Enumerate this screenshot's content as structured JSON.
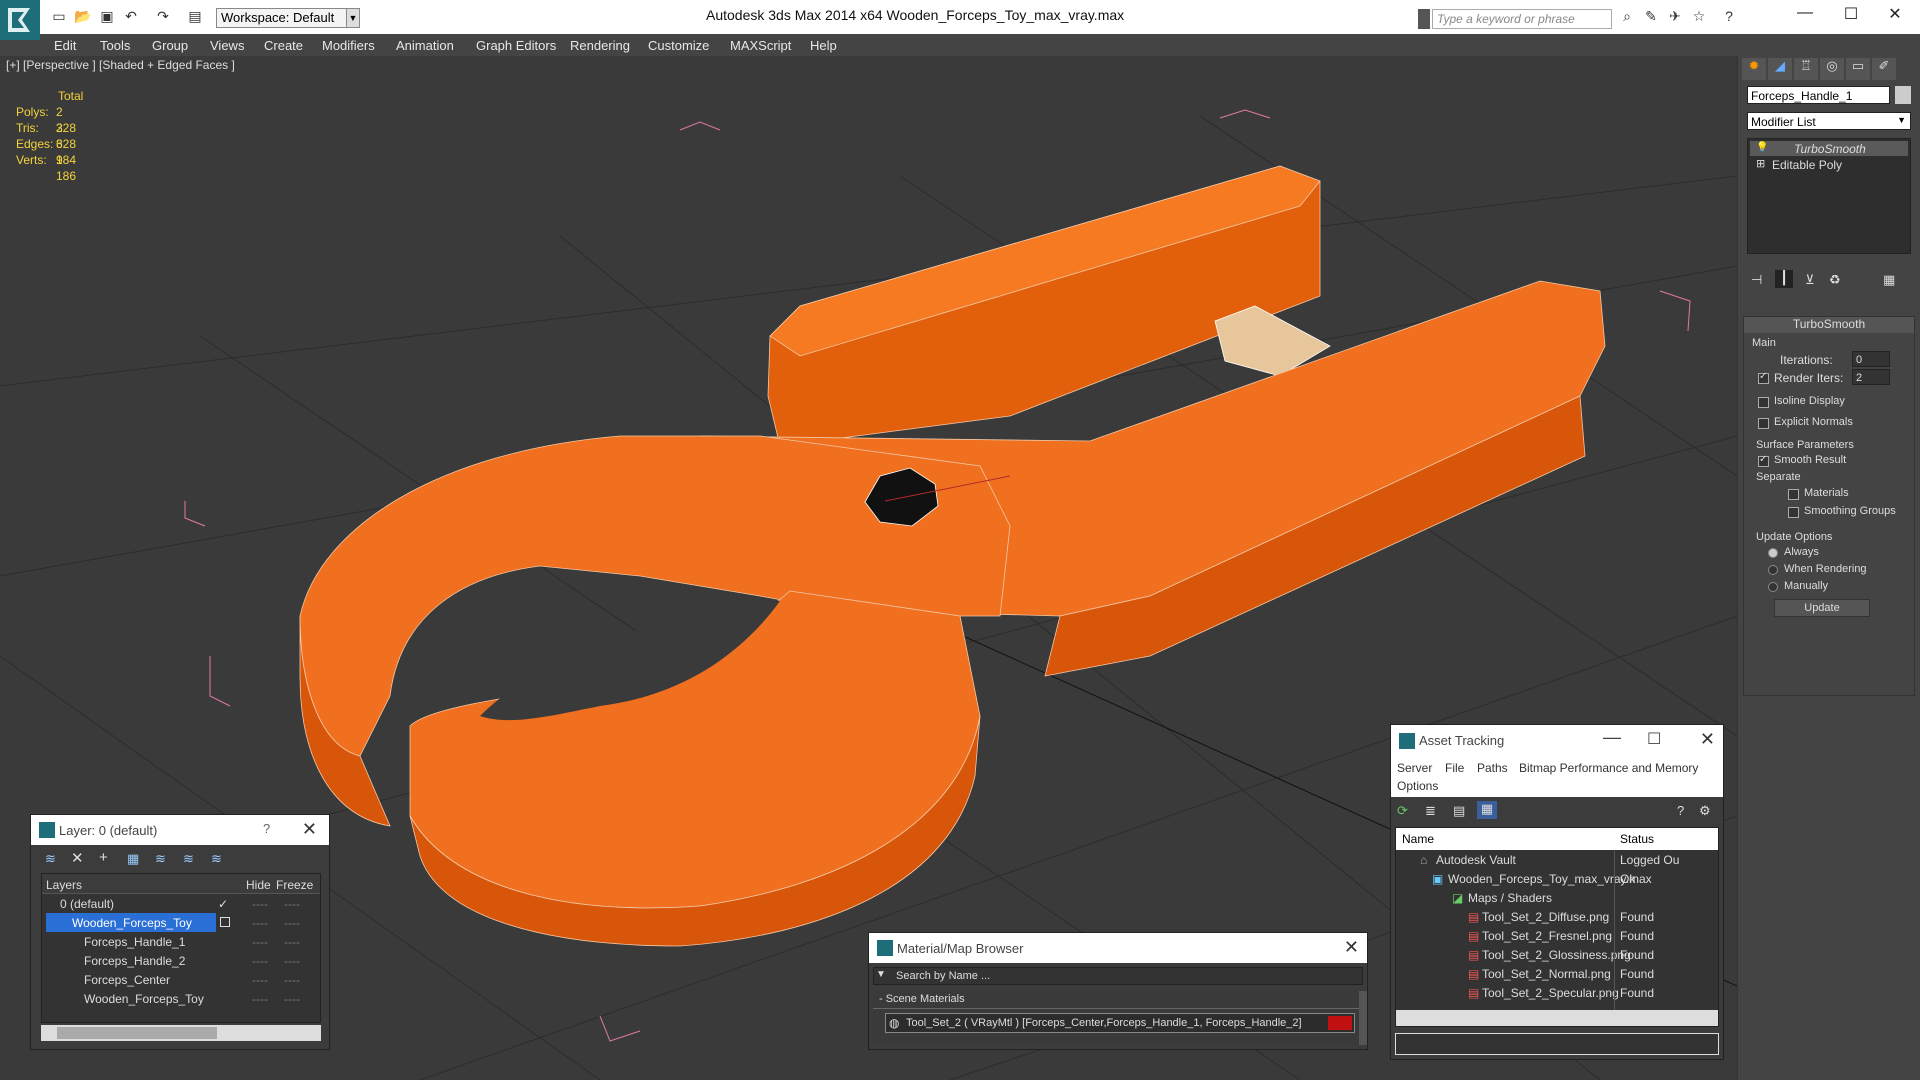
{
  "app": {
    "title": "Autodesk 3ds Max  2014 x64      Wooden_Forceps_Toy_max_vray.max",
    "workspace": "Workspace: Default",
    "search_placeholder": "Type a keyword or phrase"
  },
  "menu": [
    "Edit",
    "Tools",
    "Group",
    "Views",
    "Create",
    "Modifiers",
    "Animation",
    "Graph Editors",
    "Rendering",
    "Customize",
    "MAXScript",
    "Help"
  ],
  "viewport": {
    "label": "[+] [Perspective ] [Shaded + Edged Faces ]",
    "stats_header": "Total",
    "stats": [
      {
        "label": "Polys:",
        "value": "2 328"
      },
      {
        "label": "Tris:",
        "value": "2 328"
      },
      {
        "label": "Edges:",
        "value": "6 984"
      },
      {
        "label": "Verts:",
        "value": "1 186"
      }
    ]
  },
  "command_panel": {
    "object_name": "Forceps_Handle_1",
    "modifier_list": "Modifier List",
    "stack": [
      "TurboSmooth",
      "Editable Poly"
    ],
    "rollout_title": "TurboSmooth",
    "main_label": "Main",
    "iterations_label": "Iterations:",
    "iterations_value": "0",
    "render_iters_label": "Render Iters:",
    "render_iters_value": "2",
    "isoline_display": "Isoline Display",
    "explicit_normals": "Explicit Normals",
    "surface_params": "Surface Parameters",
    "smooth_result": "Smooth Result",
    "separate": "Separate",
    "materials": "Materials",
    "smoothing_groups": "Smoothing Groups",
    "update_options": "Update Options",
    "always": "Always",
    "when_rendering": "When Rendering",
    "manually": "Manually",
    "update_button": "Update"
  },
  "layer_dialog": {
    "title": "Layer: 0 (default)",
    "help": "?",
    "col_layers": "Layers",
    "col_hide": "Hide",
    "col_freeze": "Freeze",
    "rows": [
      {
        "name": "0 (default)"
      },
      {
        "name": "Wooden_Forceps_Toy"
      },
      {
        "name": "Forceps_Handle_1"
      },
      {
        "name": "Forceps_Handle_2"
      },
      {
        "name": "Forceps_Center"
      },
      {
        "name": "Wooden_Forceps_Toy"
      }
    ]
  },
  "material_browser": {
    "title": "Material/Map Browser",
    "search_placeholder": "Search by Name ...",
    "group": "- Scene Materials",
    "item": "Tool_Set_2  ( VRayMtl )  [Forceps_Center,Forceps_Handle_1, Forceps_Handle_2]"
  },
  "asset_tracking": {
    "title": "Asset Tracking",
    "menu": [
      "Server",
      "File",
      "Paths",
      "Bitmap Performance and Memory",
      "Options"
    ],
    "col_name": "Name",
    "col_status": "Status",
    "rows": [
      {
        "name": "Autodesk Vault",
        "status": "Logged Ou"
      },
      {
        "name": "Wooden_Forceps_Toy_max_vray.max",
        "status": "Ok"
      },
      {
        "name": "Maps / Shaders",
        "status": ""
      },
      {
        "name": "Tool_Set_2_Diffuse.png",
        "status": "Found"
      },
      {
        "name": "Tool_Set_2_Fresnel.png",
        "status": "Found"
      },
      {
        "name": "Tool_Set_2_Glossiness.png",
        "status": "Found"
      },
      {
        "name": "Tool_Set_2_Normal.png",
        "status": "Found"
      },
      {
        "name": "Tool_Set_2_Specular.png",
        "status": "Found"
      }
    ]
  },
  "colors": {
    "model_orange": "#ee6a10",
    "viewport_bg": "#3a3a3a",
    "stats_yellow": "#f3d33b",
    "selection_blue": "#2a6fd6"
  }
}
